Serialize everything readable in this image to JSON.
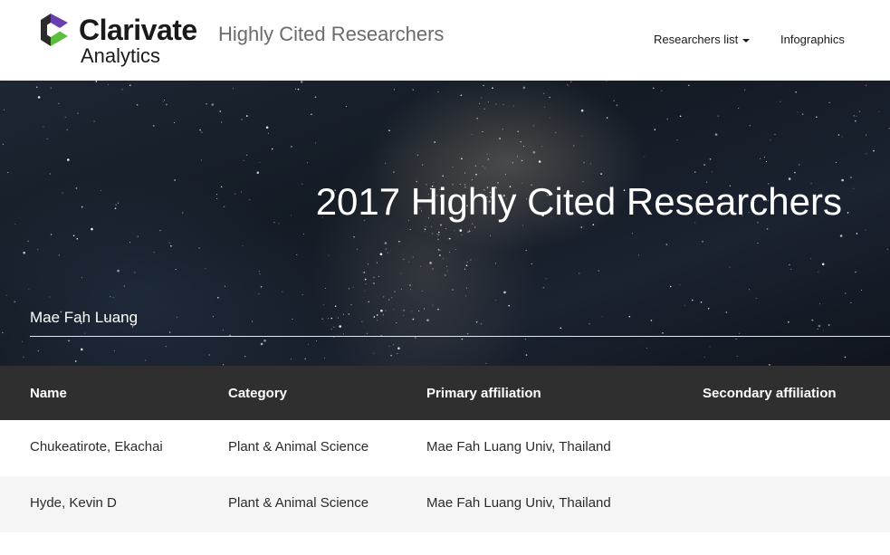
{
  "brand": {
    "name": "Clarivate",
    "sub": "Analytics",
    "site_title": "Highly Cited Researchers"
  },
  "nav": {
    "researchers_list": "Researchers list",
    "infographics": "Infographics"
  },
  "hero": {
    "title": "2017 Highly Cited Researchers",
    "search_value": "Mae Fah Luang"
  },
  "table": {
    "headers": [
      "Name",
      "Category",
      "Primary affiliation",
      "Secondary affiliation"
    ],
    "rows": [
      [
        "Chukeatirote, Ekachai",
        "Plant & Animal Science",
        "Mae Fah Luang Univ, Thailand",
        ""
      ],
      [
        "Hyde, Kevin D",
        "Plant & Animal Science",
        "Mae Fah Luang Univ, Thailand",
        ""
      ]
    ]
  },
  "colors": {
    "logo_purple": "#5b2d8e",
    "logo_green": "#5cbe3e",
    "table_header_bg": "#2f2f2f",
    "row_alt_bg": "#f5f5f5"
  },
  "icons": {
    "logo": "clarivate-logo-icon",
    "dropdown": "caret-down-icon"
  }
}
